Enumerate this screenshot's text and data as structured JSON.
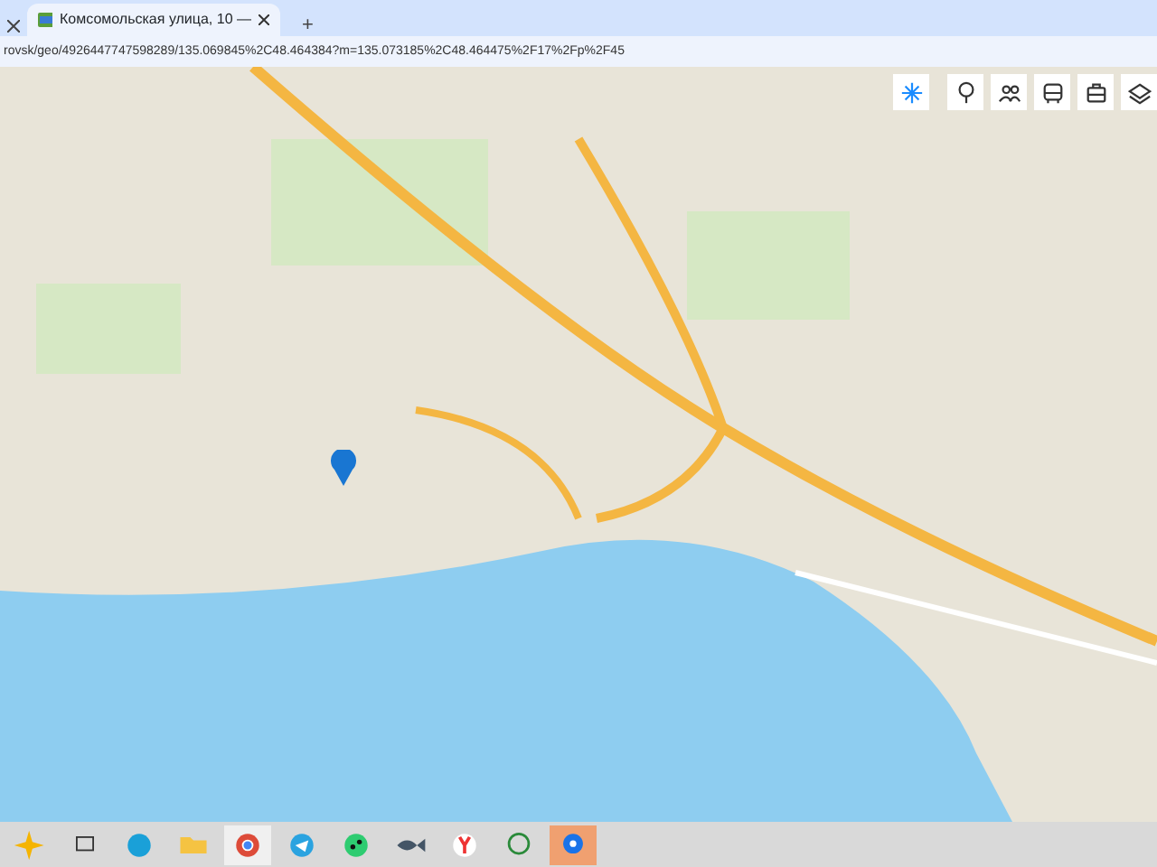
{
  "browser": {
    "tabs": [
      {
        "title": "Комсомольская улица, 10 —",
        "selected": true
      }
    ],
    "new_tab": "+",
    "address": "rovsk/geo/4926447747598289/135.069845%2C48.464384?m=135.073185%2C48.464475%2F17%2Fp%2F45"
  },
  "map_controls": [
    {
      "kind": "snow",
      "selected": true
    },
    {
      "kind": "tree",
      "selected": false
    },
    {
      "kind": "people",
      "selected": false
    },
    {
      "kind": "bus",
      "selected": false
    },
    {
      "kind": "case",
      "selected": false
    },
    {
      "kind": "layers",
      "selected": false
    }
  ],
  "taskbar": {
    "apps": [
      {
        "kind": "sparkle",
        "selected": false
      },
      {
        "kind": "taskview",
        "selected": false
      },
      {
        "kind": "edge",
        "selected": false
      },
      {
        "kind": "folder",
        "selected": false
      },
      {
        "kind": "chrome",
        "selected": true
      },
      {
        "kind": "telegram",
        "selected": false
      },
      {
        "kind": "game",
        "selected": false
      },
      {
        "kind": "dash",
        "selected": false
      },
      {
        "kind": "yandex",
        "selected": false
      },
      {
        "kind": "whatsapp",
        "selected": false
      },
      {
        "kind": "pin",
        "selected": true
      }
    ]
  }
}
